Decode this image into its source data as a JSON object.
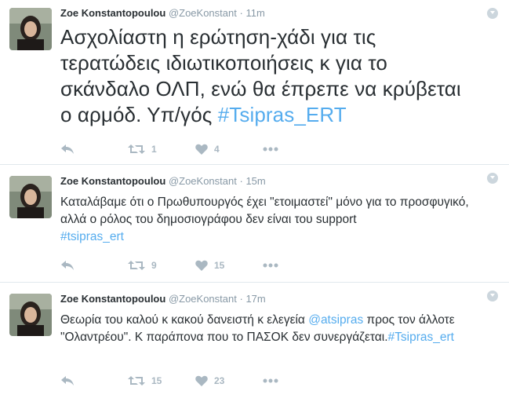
{
  "tweets": [
    {
      "name": "Zoe Konstantopoulou",
      "handle": "@ZoeKonstant",
      "separator": "·",
      "time": "11m",
      "text_parts": [
        "Ασχολίαστη η ερώτηση-χάδι για τις τερατώδεις ιδιωτικοποιήσεις κ για το σκάνδαλο ΟΛΠ, ενώ θα έπρεπε να κρύβεται ο αρμόδ. Υπ/γός ",
        "#Tsipras_ERT"
      ],
      "retweets": "1",
      "likes": "4"
    },
    {
      "name": "Zoe Konstantopoulou",
      "handle": "@ZoeKonstant",
      "separator": "·",
      "time": "15m",
      "text_parts": [
        "Καταλάβαμε ότι ο Πρωθυπουργός έχει \"ετοιμαστεί\" μόνο για το προσφυγικό, αλλά ο ρόλος του δημοσιογράφου δεν είναι του support ",
        "#tsipras_ert"
      ],
      "retweets": "9",
      "likes": "15"
    },
    {
      "name": "Zoe Konstantopoulou",
      "handle": "@ZoeKonstant",
      "separator": "·",
      "time": "17m",
      "text_parts": [
        "Θεωρία του καλού κ κακού δανειστή κ ελεγεία ",
        "@atsipras",
        " προς τον άλλοτε \"Ολαντρέου\". Κ παράπονα που το ΠΑΣΟΚ δεν συνεργάζεται.",
        "#Tsipras_ert"
      ],
      "retweets": "15",
      "likes": "23"
    }
  ],
  "colors": {
    "link": "#55acee",
    "muted": "#8899a6",
    "icon": "#aab8c2",
    "text": "#292f33"
  },
  "icons": {
    "reply": "reply-icon",
    "retweet": "retweet-icon",
    "like": "heart-icon",
    "more": "more-icon",
    "caret": "caret-icon"
  }
}
